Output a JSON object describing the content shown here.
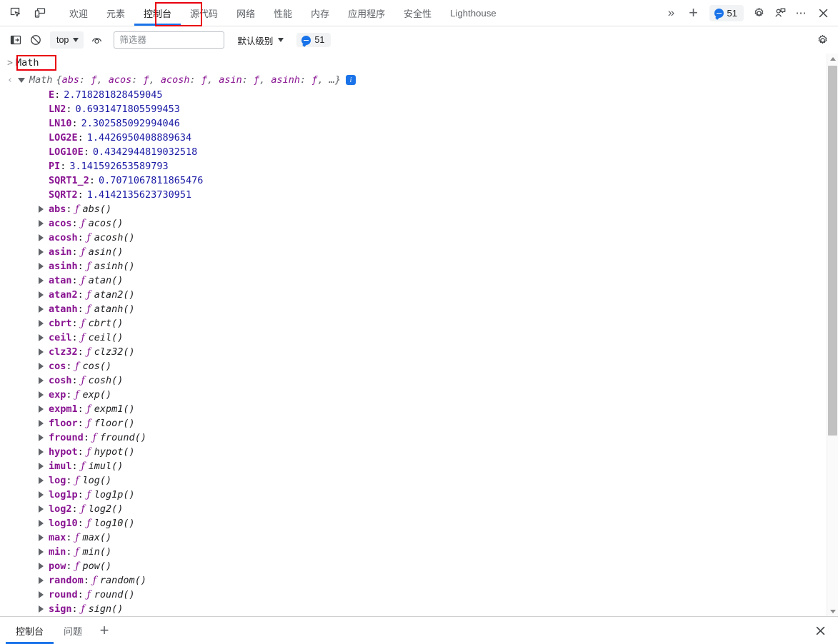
{
  "tabbar": {
    "inspect_icon": "inspect-element-icon",
    "device_icon": "device-toolbar-icon",
    "tabs": [
      {
        "label": "欢迎",
        "active": false
      },
      {
        "label": "元素",
        "active": false
      },
      {
        "label": "控制台",
        "active": true
      },
      {
        "label": "源代码",
        "active": false
      },
      {
        "label": "网络",
        "active": false
      },
      {
        "label": "性能",
        "active": false
      },
      {
        "label": "内存",
        "active": false
      },
      {
        "label": "应用程序",
        "active": false
      },
      {
        "label": "安全性",
        "active": false
      },
      {
        "label": "Lighthouse",
        "active": false
      }
    ],
    "more_tabs": "»",
    "add_tab": "+",
    "message_count": "51",
    "settings_icon": "gear-icon",
    "feedback_icon": "feedback-icon",
    "more_options": "⋯",
    "close": "✕"
  },
  "console_toolbar": {
    "sidebar_icon": "console-sidebar-icon",
    "clear_icon": "clear-console-icon",
    "context": "top",
    "eye_icon": "live-expression-eye-icon",
    "filter_placeholder": "筛选器",
    "filter_value": "",
    "level": "默认级别",
    "message_count": "51",
    "settings_icon": "gear-icon"
  },
  "console": {
    "prompt_symbol": ">",
    "input_value": "Math",
    "return_symbol": "‹",
    "object_name": "Math",
    "preview_prefix": "{",
    "preview_items": [
      {
        "key": "abs",
        "val": "ƒ"
      },
      {
        "key": "acos",
        "val": "ƒ"
      },
      {
        "key": "acosh",
        "val": "ƒ"
      },
      {
        "key": "asin",
        "val": "ƒ"
      },
      {
        "key": "asinh",
        "val": "ƒ"
      }
    ],
    "preview_ellipsis": "…}",
    "info_badge": "i",
    "constants": [
      {
        "key": "E",
        "value": "2.718281828459045"
      },
      {
        "key": "LN2",
        "value": "0.6931471805599453"
      },
      {
        "key": "LN10",
        "value": "2.302585092994046"
      },
      {
        "key": "LOG2E",
        "value": "1.4426950408889634"
      },
      {
        "key": "LOG10E",
        "value": "0.4342944819032518"
      },
      {
        "key": "PI",
        "value": "3.141592653589793"
      },
      {
        "key": "SQRT1_2",
        "value": "0.7071067811865476"
      },
      {
        "key": "SQRT2",
        "value": "1.4142135623730951"
      }
    ],
    "functions": [
      "abs",
      "acos",
      "acosh",
      "asin",
      "asinh",
      "atan",
      "atan2",
      "atanh",
      "cbrt",
      "ceil",
      "clz32",
      "cos",
      "cosh",
      "exp",
      "expm1",
      "floor",
      "fround",
      "hypot",
      "imul",
      "log",
      "log1p",
      "log2",
      "log10",
      "max",
      "min",
      "pow",
      "random",
      "round",
      "sign"
    ],
    "fn_marker": "ƒ",
    "fn_suffix": "()"
  },
  "drawer": {
    "tabs": [
      {
        "label": "控制台",
        "active": true
      },
      {
        "label": "问题",
        "active": false
      }
    ],
    "add": "+",
    "close": "✕"
  },
  "colors": {
    "accent": "#1a73e8",
    "highlight_box": "#e8000d",
    "key_purple": "#881391",
    "number_blue": "#1a1aa6"
  }
}
